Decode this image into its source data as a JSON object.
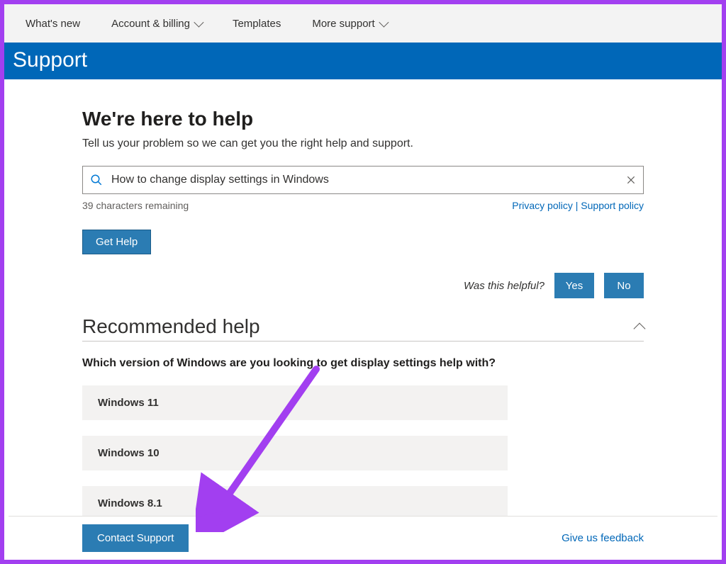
{
  "topnav": {
    "whats_new": "What's new",
    "account": "Account & billing",
    "templates": "Templates",
    "more": "More support"
  },
  "banner": {
    "title": "Support"
  },
  "hero": {
    "title": "We're here to help",
    "subtitle": "Tell us your problem so we can get you the right help and support."
  },
  "search": {
    "value": "How to change display settings in Windows",
    "chars_remaining": "39 characters remaining"
  },
  "policies": {
    "privacy": "Privacy policy",
    "separator": " | ",
    "support": "Support policy"
  },
  "buttons": {
    "get_help": "Get Help",
    "contact": "Contact Support"
  },
  "helpful": {
    "label": "Was this helpful?",
    "yes": "Yes",
    "no": "No"
  },
  "recommended": {
    "title": "Recommended help",
    "question": "Which version of Windows are you looking to get display settings help with?",
    "options": [
      "Windows 11",
      "Windows 10",
      "Windows 8.1"
    ]
  },
  "footer": {
    "feedback": "Give us feedback"
  }
}
